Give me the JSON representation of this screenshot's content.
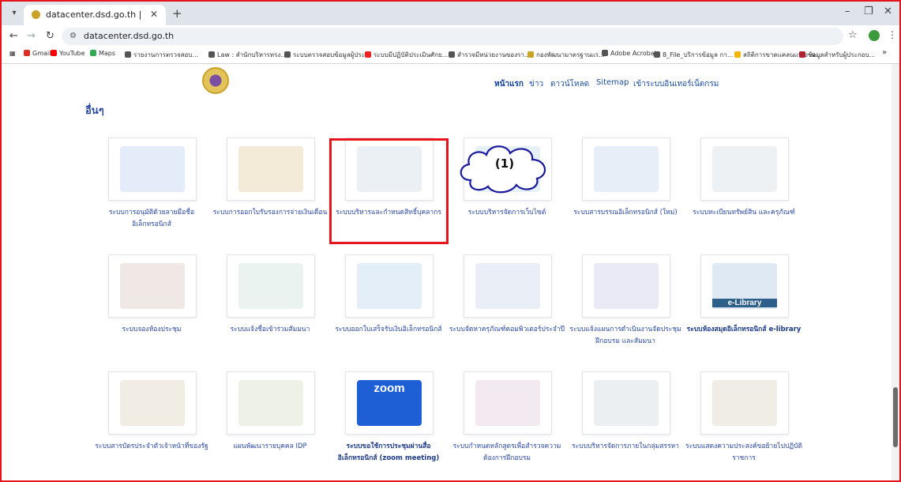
{
  "browser": {
    "tab_title": "datacenter.dsd.go.th |",
    "url": "datacenter.dsd.go.th",
    "bookmarks": [
      "Gmail",
      "YouTube",
      "Maps",
      "รายงานการตรวจสอบ...",
      "Law : สำนักบริหารทรง...",
      "ระบบตรวจสอบข้อมูลผู้ประ...",
      "ระบบมีปฏิบัติประเมินศักย...",
      "สำรวจมีหน่วยงานของรา...",
      "กองพัฒนามาตรฐานแร...",
      "Adobe Acrobat",
      "8_File_บริการข้อมูล กา...",
      "สถิติการขาดแคลนแรงงาน...",
      "ข้อมูลสำหรับผู้ประกอบ..."
    ],
    "bookmarks_more": "»"
  },
  "header": {
    "nav": [
      "หน้าแรก",
      "ข่าว",
      "ดาวน์โหลด",
      "Sitemap",
      "เข้าระบบอินเทอร์เน็ตกรม"
    ]
  },
  "section_title": "อื่นๆ",
  "cards": [
    {
      "label": "ระบบการอนุมัติด้วยลายมือชื่ออิเล็กทรอนิกส์",
      "art": "signature-art"
    },
    {
      "label": "ระบบการออกใบรับรองการจ่ายเงินเดือน",
      "art": "finance-art"
    },
    {
      "label": "ระบบบริหารและกำหนดสิทธิ์บุคลากร",
      "art": "people-art"
    },
    {
      "label": "ระบบบริหารจัดการเว็บไซต์",
      "art": "website-art"
    },
    {
      "label": "ระบบสารบรรณอิเล็กทรอนิกส์ (ใหม่)",
      "art": "document-art"
    },
    {
      "label": "ระบบทะเบียนทรัพย์สิน และครุภัณฑ์",
      "art": "assets-art"
    },
    {
      "label": "ระบบจองห้องประชุม",
      "art": "meeting-room-art"
    },
    {
      "label": "ระบบแจ้งชื่อเข้าร่วมสัมมนา",
      "art": "checklist-art"
    },
    {
      "label": "ระบบออกใบเสร็จรับเงินอิเล็กทรอนิกส์",
      "art": "receipt-art"
    },
    {
      "label": "ระบบจัดหาครุภัณฑ์คอมพิวเตอร์ประจำปี",
      "art": "computer-art"
    },
    {
      "label": "ระบบแจ้งแผนการดำเนินงานจัดประชุม ฝึกอบรม และสัมมนา",
      "art": "calendar-art"
    },
    {
      "label": "ระบบห้องสมุดอิเล็กทรอนิกส์ e-library",
      "art": "library-art",
      "img_text": "e-Library"
    },
    {
      "label": "ระบบสารบัตรประจำตัวเจ้าหน้าที่ของรัฐ",
      "art": "id-card-art"
    },
    {
      "label": "แผนพัฒนารายบุคคล IDP",
      "art": "idp-art"
    },
    {
      "label": "ระบบขอใช้การประชุมผ่านสื่ออิเล็กทรอนิกส์ (zoom meeting)",
      "art": "zoom-art",
      "img_text": "zoom"
    },
    {
      "label": "ระบบกำหนดหลักสูตรเพื่อสำรวจความต้องการฝึกอบรม",
      "art": "training-art"
    },
    {
      "label": "ระบบบริหารจัดการภายในกลุ่มสรรหา",
      "art": "recruit-art"
    },
    {
      "label": "ระบบแสดงความประสงค์ขอย้ายไปปฏิบัติราชการ",
      "art": "transfer-art"
    }
  ],
  "annotation": {
    "label": "(1)"
  },
  "colors": {
    "highlight": "#e8141c",
    "link": "#2a4aa0"
  }
}
